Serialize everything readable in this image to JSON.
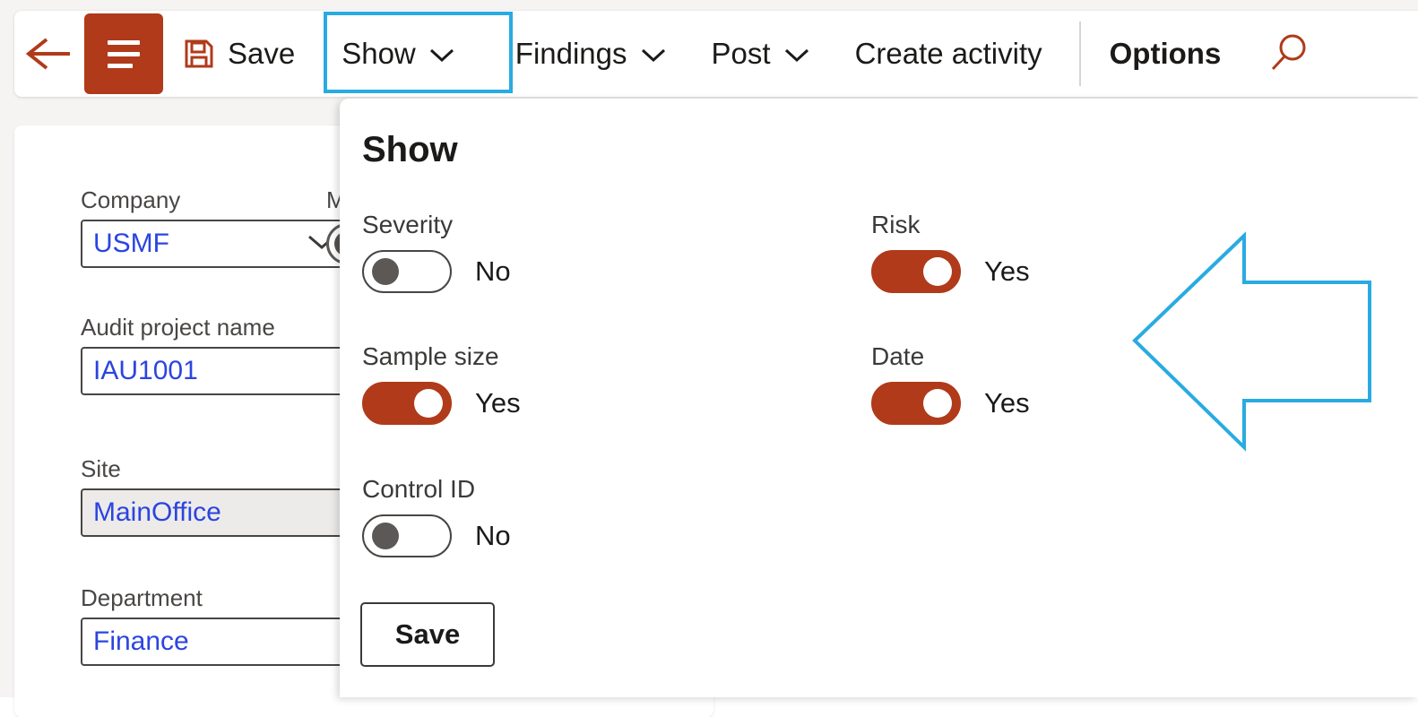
{
  "toolbar": {
    "back_icon": "arrow-left-icon",
    "menu_icon": "hamburger-menu-icon",
    "save_icon": "floppy-save-icon",
    "save_label": "Save",
    "show_label": "Show",
    "findings_label": "Findings",
    "post_label": "Post",
    "create_activity_label": "Create activity",
    "options_label": "Options",
    "search_icon": "search-icon",
    "chevron": "∨"
  },
  "form": {
    "company": {
      "label": "Company",
      "value": "USMF",
      "type": "dropdown"
    },
    "m_field": {
      "label": "M",
      "type": "toggle-partial"
    },
    "audit_project_name": {
      "label": "Audit project name",
      "value": "IAU1001"
    },
    "site": {
      "label": "Site",
      "value": "MainOffice"
    },
    "department": {
      "label": "Department",
      "value": "Finance"
    }
  },
  "show_panel": {
    "title": "Show",
    "toggles": [
      {
        "label": "Severity",
        "state": "No",
        "on": false
      },
      {
        "label": "Sample size",
        "state": "Yes",
        "on": true
      },
      {
        "label": "Control ID",
        "state": "No",
        "on": false
      },
      {
        "label": "Risk",
        "state": "Yes",
        "on": true
      },
      {
        "label": "Date",
        "state": "Yes",
        "on": true
      }
    ],
    "save_label": "Save"
  },
  "annotations": {
    "highlight_box_target": "Show",
    "arrow_direction": "left",
    "color": "#29abe2"
  },
  "colors": {
    "accent": "#b03a1a",
    "link": "#2b44e0",
    "page_background": "#f6f4f3",
    "card_background": "#ffffff",
    "annotation_blue": "#29abe2"
  }
}
